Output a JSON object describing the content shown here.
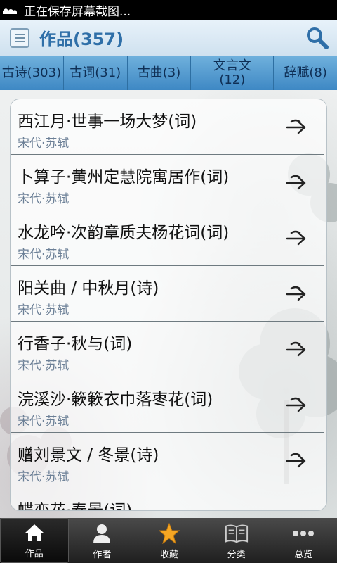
{
  "status_bar": {
    "text": "正在保存屏幕截图..."
  },
  "header": {
    "title": "作品(357)"
  },
  "tabs": [
    {
      "label": "古诗(303)"
    },
    {
      "label": "古词(31)"
    },
    {
      "label": "古曲(3)"
    },
    {
      "label": "文言文(12)"
    },
    {
      "label": "辞赋(8)"
    }
  ],
  "works": [
    {
      "title": "西江月·世事一场大梦(词)",
      "author": "宋代·苏轼"
    },
    {
      "title": "卜算子·黄州定慧院寓居作(词)",
      "author": "宋代·苏轼"
    },
    {
      "title": "水龙吟·次韵章质夫杨花词(词)",
      "author": "宋代·苏轼"
    },
    {
      "title": "阳关曲 / 中秋月(诗)",
      "author": "宋代·苏轼"
    },
    {
      "title": "行香子·秋与(词)",
      "author": "宋代·苏轼"
    },
    {
      "title": "浣溪沙·簌簌衣巾落枣花(词)",
      "author": "宋代·苏轼"
    },
    {
      "title": "赠刘景文 / 冬景(诗)",
      "author": "宋代·苏轼"
    },
    {
      "title": "蝶恋花·春景(词)",
      "author": ""
    }
  ],
  "bottom_nav": [
    {
      "label": "作品",
      "icon": "home-icon",
      "active": true
    },
    {
      "label": "作者",
      "icon": "person-icon",
      "active": false
    },
    {
      "label": "收藏",
      "icon": "star-icon",
      "active": false
    },
    {
      "label": "分类",
      "icon": "book-icon",
      "active": false
    },
    {
      "label": "总览",
      "icon": "more-icon",
      "active": false
    }
  ],
  "colors": {
    "accent": "#2f6fa8",
    "tab_bar": "#4f96cf",
    "nav_bar": "#2a2a2a",
    "star": "#f5a623"
  }
}
